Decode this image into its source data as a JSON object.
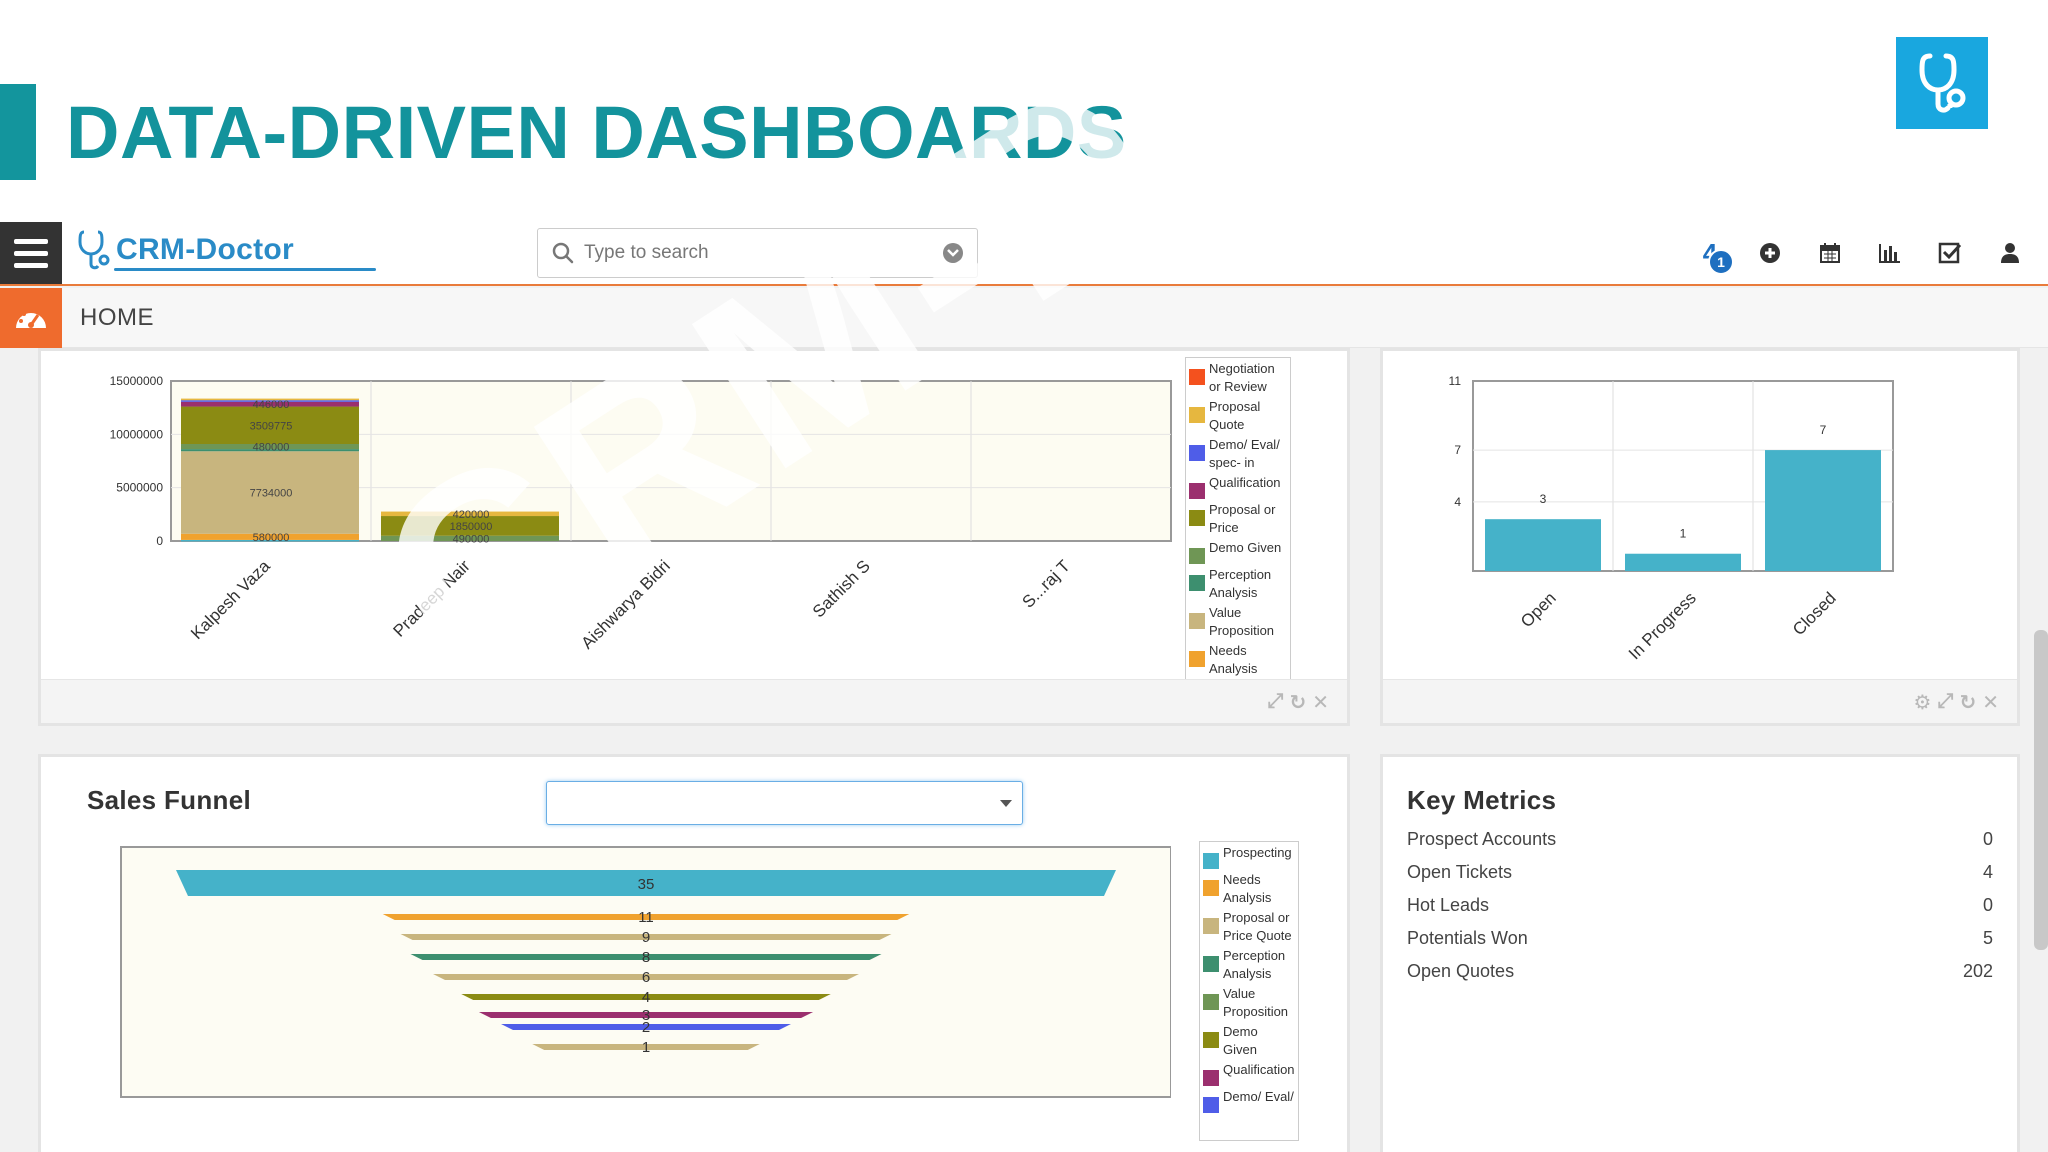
{
  "slide": {
    "title": "DATA-DRIVEN DASHBOARDS",
    "watermark": "CRM-DOCTOR",
    "accent_color": "#13959d",
    "corner_logo_icon": "stethoscope-icon"
  },
  "app": {
    "brand": "CRM-Doctor",
    "search_placeholder": "Type to search",
    "notification_count": "4",
    "notification_badge": "1",
    "nav_label": "HOME",
    "top_icons": [
      "notifications-icon",
      "add-circle-icon",
      "calendar-icon",
      "bar-chart-icon",
      "checkbox-icon",
      "user-icon"
    ]
  },
  "pipeline_panel": {
    "legend": [
      {
        "label": "Negotiation or Review",
        "color": "#f4511e"
      },
      {
        "label": "Proposal Quote",
        "color": "#e6b73f"
      },
      {
        "label": "Demo/ Eval/ spec- in",
        "color": "#4f5de8"
      },
      {
        "label": "Qualification",
        "color": "#9b2f6e"
      },
      {
        "label": "Proposal or Price",
        "color": "#8b8b13"
      },
      {
        "label": "Demo Given",
        "color": "#6f9655"
      },
      {
        "label": "Perception Analysis",
        "color": "#3d8f6f"
      },
      {
        "label": "Value Proposition",
        "color": "#c8b57e"
      },
      {
        "label": "Needs Analysis",
        "color": "#f0a22e"
      },
      {
        "label": "Prospecting",
        "color": "#45b2c9"
      }
    ]
  },
  "funnel_panel": {
    "title": "Sales Funnel",
    "select_value": "",
    "legend": [
      {
        "label": "Prospecting",
        "color": "#45b2c9"
      },
      {
        "label": "Needs Analysis",
        "color": "#f0a22e"
      },
      {
        "label": "Proposal or Price Quote",
        "color": "#c8b57e"
      },
      {
        "label": "Perception Analysis",
        "color": "#3d8f6f"
      },
      {
        "label": "Value Proposition",
        "color": "#6f9655"
      },
      {
        "label": "Demo Given",
        "color": "#8b8b13"
      },
      {
        "label": "Qualification",
        "color": "#9b2f6e"
      },
      {
        "label": "Demo/ Eval/",
        "color": "#4f5de8"
      }
    ]
  },
  "metrics_panel": {
    "title": "Key Metrics",
    "rows": [
      {
        "label": "Prospect Accounts",
        "value": "0"
      },
      {
        "label": "Open Tickets",
        "value": "4"
      },
      {
        "label": "Hot Leads",
        "value": "0"
      },
      {
        "label": "Potentials Won",
        "value": "5"
      },
      {
        "label": "Open Quotes",
        "value": "202"
      }
    ]
  },
  "chart_data": [
    {
      "type": "bar",
      "stacked": true,
      "categories": [
        "Kalpesh Vaza",
        "Pradeep Nair",
        "Aishwarya Bidri",
        "Sathish S",
        "S...raj T"
      ],
      "ylim": [
        0,
        15000000
      ],
      "yticks": [
        "15000000",
        "10000000",
        "5000000",
        "0"
      ],
      "series": [
        {
          "name": "Prospecting",
          "color": "#45b2c9",
          "values": [
            100000,
            0,
            0,
            0,
            0
          ]
        },
        {
          "name": "Needs Analysis",
          "color": "#f0a22e",
          "values": [
            580000,
            0,
            0,
            0,
            0
          ]
        },
        {
          "name": "Value Proposition",
          "color": "#c8b57e",
          "values": [
            7734000,
            0,
            0,
            0,
            0
          ]
        },
        {
          "name": "Perception Analysis",
          "color": "#3d8f6f",
          "values": [
            200000,
            0,
            0,
            0,
            0
          ]
        },
        {
          "name": "Demo Given",
          "color": "#6f9655",
          "values": [
            480000,
            490000,
            0,
            0,
            0
          ]
        },
        {
          "name": "Proposal or Price",
          "color": "#8b8b13",
          "values": [
            3509775,
            1850000,
            0,
            0,
            0
          ]
        },
        {
          "name": "Qualification",
          "color": "#9b2f6e",
          "values": [
            446000,
            0,
            0,
            0,
            0
          ]
        },
        {
          "name": "Demo/ Eval/ spec- in",
          "color": "#4f5de8",
          "values": [
            150000,
            0,
            0,
            0,
            0
          ]
        },
        {
          "name": "Proposal Quote",
          "color": "#e6b73f",
          "values": [
            150000,
            420000,
            0,
            0,
            0
          ]
        },
        {
          "name": "Negotiation or Review",
          "color": "#f4511e",
          "values": [
            0,
            0,
            0,
            0,
            0
          ]
        }
      ],
      "data_labels": [
        {
          "category": 0,
          "series": 6,
          "text": "446000"
        },
        {
          "category": 0,
          "series": 5,
          "text": "3509775"
        },
        {
          "category": 0,
          "series": 4,
          "text": "480000"
        },
        {
          "category": 0,
          "series": 2,
          "text": "7734000"
        },
        {
          "category": 0,
          "series": 1,
          "text": "580000"
        },
        {
          "category": 1,
          "series": 8,
          "text": "420000"
        },
        {
          "category": 1,
          "series": 5,
          "text": "1850000"
        },
        {
          "category": 1,
          "series": 4,
          "text": "490000"
        }
      ]
    },
    {
      "type": "bar",
      "categories": [
        "Open",
        "In Progress",
        "Closed"
      ],
      "values": [
        3,
        1,
        7
      ],
      "ylim": [
        0,
        11
      ],
      "yticks": [
        11,
        7,
        4
      ],
      "color": "#45b2c9"
    },
    {
      "type": "funnel",
      "values": [
        35,
        11,
        9,
        8,
        6,
        4,
        3,
        2,
        1
      ],
      "colors": [
        "#45b2c9",
        "#f0a22e",
        "#c8b57e",
        "#3d8f6f",
        "#c8b57e",
        "#8b8b13",
        "#9b2f6e",
        "#4f5de8",
        "#c8b57e"
      ]
    }
  ]
}
